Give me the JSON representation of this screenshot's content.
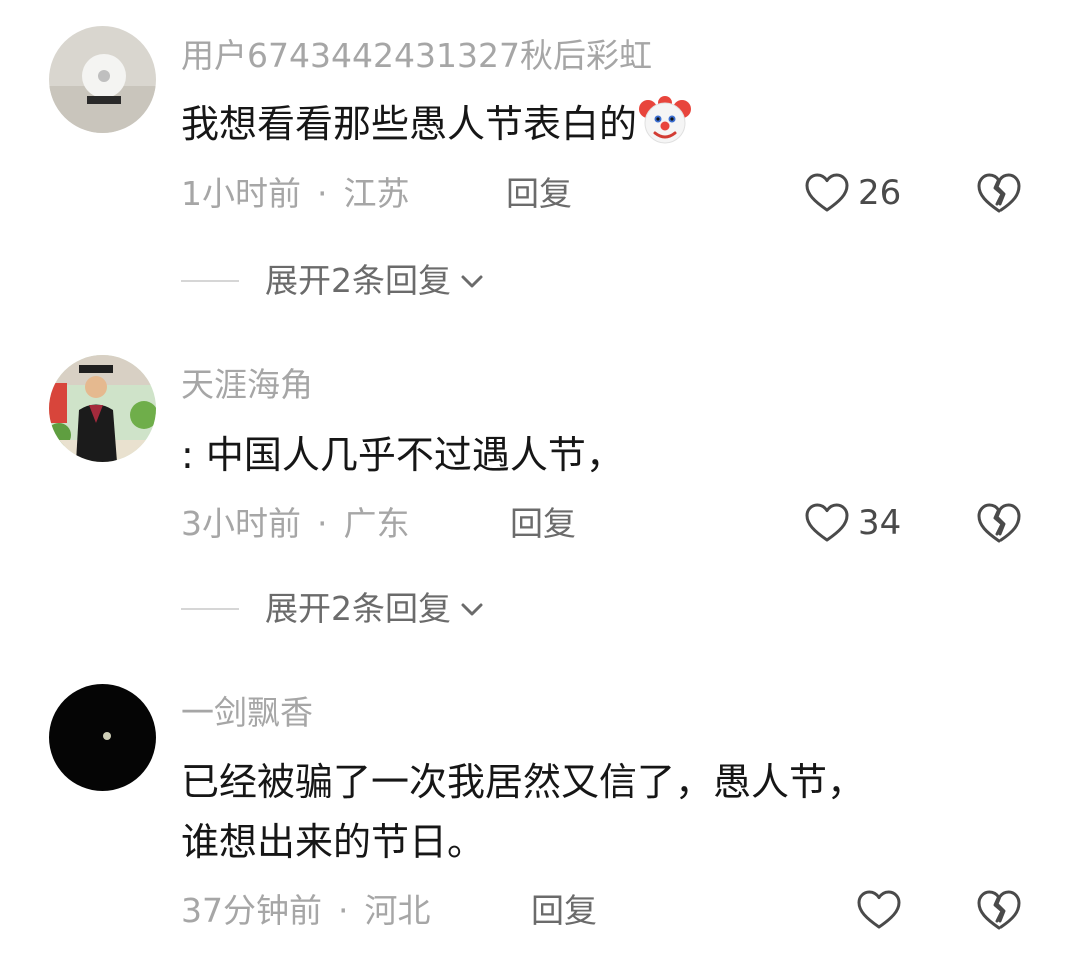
{
  "comments": [
    {
      "username": "用户6743442431327秋后彩虹",
      "content": "我想看看那些愚人节表白的",
      "emoji": "clown-face-icon",
      "time": "1小时前",
      "separator": "·",
      "location": "江苏",
      "reply_label": "回复",
      "likes": "26",
      "expand_label": "展开2条回复"
    },
    {
      "username": "天涯海角",
      "content": ": 中国人几乎不过遇人节，",
      "time": "3小时前",
      "separator": "·",
      "location": "广东",
      "reply_label": "回复",
      "likes": "34",
      "expand_label": "展开2条回复"
    },
    {
      "username": "一剑飘香",
      "content_lines": [
        "已经被骗了一次我居然又信了，愚人节，",
        "谁想出来的节日。"
      ],
      "time": "37分钟前",
      "separator": "·",
      "location": "河北",
      "reply_label": "回复"
    }
  ]
}
